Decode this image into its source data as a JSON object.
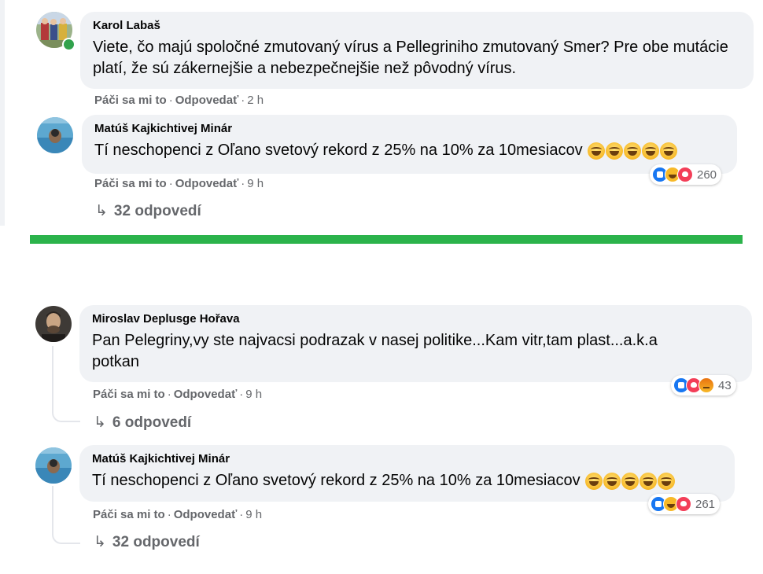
{
  "comments": [
    {
      "author": "Karol Labaš",
      "text": "Viete, čo majú spoločné zmutovaný vírus a Pellegriniho zmutovaný Smer? Pre obe mutácie platí, že sú zákernejšie a nebezpečnejšie než pôvodný vírus.",
      "like_label": "Páči sa mi to",
      "reply_label": "Odpovedať",
      "time": "2 h",
      "online": true
    },
    {
      "author": "Matúš Kajkichtivej Minár",
      "text": "Tí neschopenci z Oľano svetový rekord z 25% na 10% za 10mesiacov",
      "emojis": [
        "laughing-tears-emoji",
        "laughing-tears-emoji",
        "laughing-tears-emoji",
        "laughing-tears-emoji",
        "laughing-tears-emoji"
      ],
      "like_label": "Páči sa mi to",
      "reply_label": "Odpovedať",
      "time": "9 h",
      "reactions": [
        "like",
        "haha",
        "love"
      ],
      "reaction_count": "260",
      "replies_label": "32 odpovedí"
    },
    {
      "author": "Miroslav Deplusge Hořava",
      "text": "Pan Pelegriny,vy ste najvacsi podrazak v nasej politike...Kam vitr,tam plast...a.k.a potkan",
      "like_label": "Páči sa mi to",
      "reply_label": "Odpovedať",
      "time": "9 h",
      "reactions": [
        "like",
        "love",
        "angry"
      ],
      "reaction_count": "43",
      "replies_label": "6 odpovedí"
    },
    {
      "author": "Matúš Kajkichtivej Minár",
      "text": "Tí neschopenci z Oľano svetový rekord z 25% na 10% za 10mesiacov",
      "emojis": [
        "laughing-tears-emoji",
        "laughing-tears-emoji",
        "laughing-tears-emoji",
        "laughing-tears-emoji",
        "laughing-tears-emoji"
      ],
      "like_label": "Páči sa mi to",
      "reply_label": "Odpovedať",
      "time": "9 h",
      "reactions": [
        "like",
        "haha",
        "love"
      ],
      "reaction_count": "261",
      "replies_label": "32 odpovedí"
    }
  ],
  "separator": "·",
  "reply_arrow_icon": "reply-arrow-icon",
  "colors": {
    "bubble": "#f0f2f5",
    "divider": "#2bb34b",
    "meta": "#65676b",
    "like": "#1877f2",
    "love": "#f33e58",
    "haha": "#f7b928"
  }
}
